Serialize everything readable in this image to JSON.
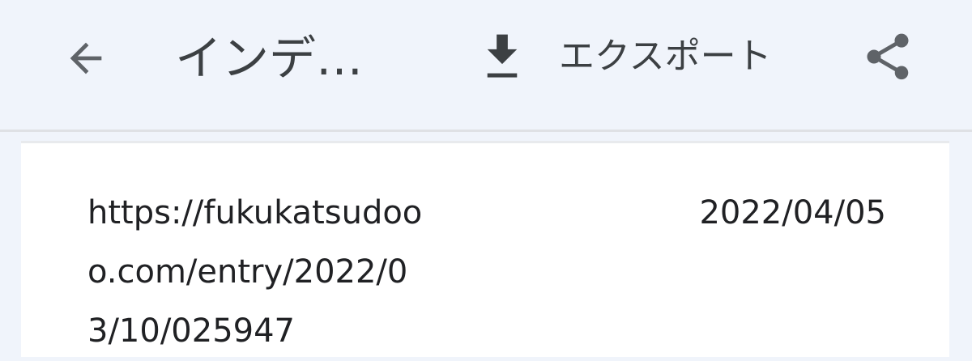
{
  "header": {
    "title": "インデ…",
    "export_label": "エクスポート"
  },
  "icons": {
    "back": "arrow-back-icon",
    "export": "download-icon",
    "share": "share-icon"
  },
  "colors": {
    "header_background": "#f0f4fb",
    "card_background": "#ffffff",
    "icon_gray": "#5f6368",
    "text_dark": "#202124"
  },
  "entries": [
    {
      "url": "https://fukukatsudooo.com/entry/2022/03/10/025947",
      "date": "2022/04/05"
    }
  ]
}
